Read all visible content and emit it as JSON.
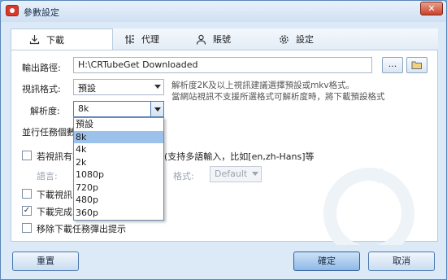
{
  "window": {
    "title": "參數設定",
    "close_label": "✕"
  },
  "tabs": [
    {
      "label": "下載",
      "icon": "download-icon"
    },
    {
      "label": "代理",
      "icon": "proxy-icon"
    },
    {
      "label": "賬號",
      "icon": "user-icon"
    },
    {
      "label": "設定",
      "icon": "gear-icon"
    }
  ],
  "download": {
    "output_path_label": "輸出路徑:",
    "output_path_value": "H:\\CRTubeGet Downloaded",
    "more_label": "...",
    "video_format_label": "視訊格式:",
    "video_format_value": "預設",
    "format_note_1": "解析度2K及以上視訊建議選擇預設或mkv格式。",
    "format_note_2": "當網站視訊不支援所選格式可解析度時，將下載預設格式",
    "resolution_label": "解析度:",
    "resolution_value": "8k",
    "resolution_options": [
      "預設",
      "8k",
      "4k",
      "2k",
      "1080p",
      "720p",
      "480p",
      "360p"
    ],
    "selected_option_index": 1,
    "parallel_label": "並行任務個數",
    "subtitle_check_label_a": "若視訊有字",
    "subtitle_check_label_b": "(支持多語輸入，比如[en,zh-Hans]等",
    "language_label": "語言:",
    "format_label": "格式:",
    "format_value": "Default",
    "download_video_label": "下載視訊",
    "download_complete_label": "下載完成",
    "remove_prompt_label": "移除下載任務彈出提示"
  },
  "footer": {
    "reset_label": "重置",
    "ok_label": "確定",
    "cancel_label": "取消"
  },
  "colors": {
    "accent": "#9cc1ea",
    "window_bg": "#dce9f7",
    "brand": "#d9392b"
  }
}
